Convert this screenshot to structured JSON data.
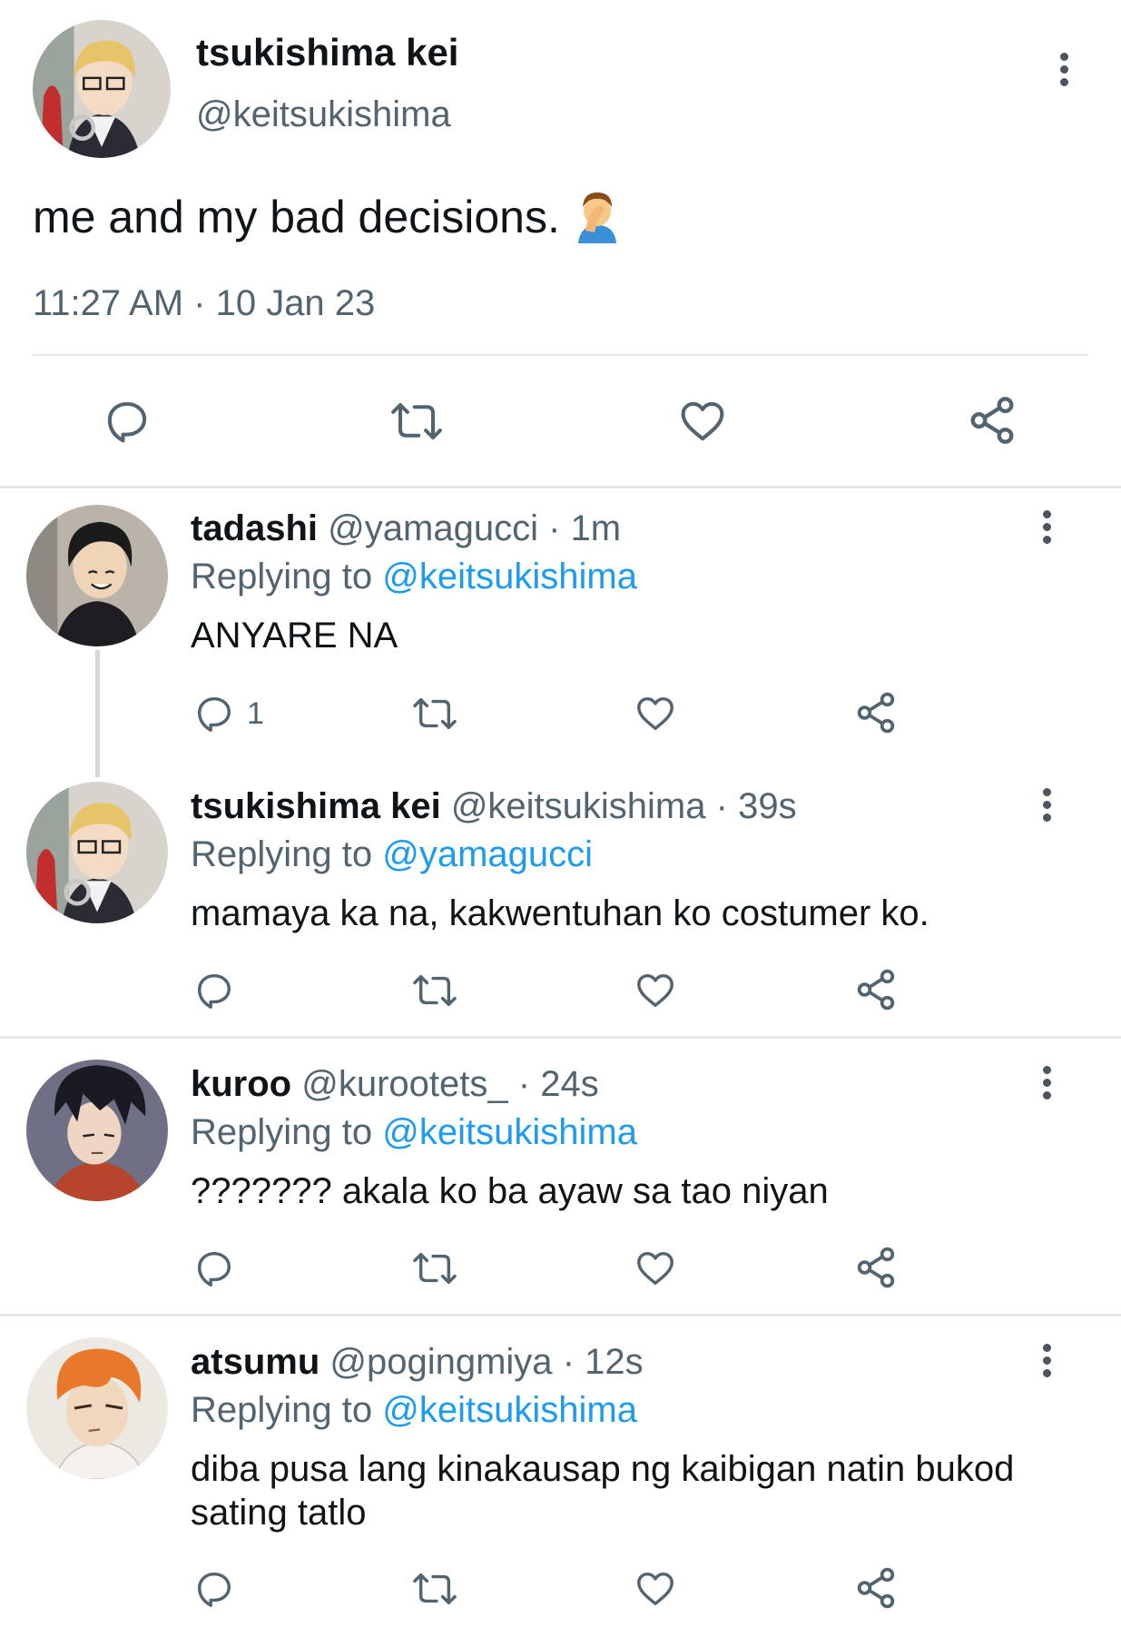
{
  "main_tweet": {
    "name": "tsukishima kei",
    "handle": "@keitsukishima",
    "text": "me and my bad decisions.",
    "emoji": "facepalm-emoji",
    "timestamp": "11:27 AM · 10 Jan 23"
  },
  "replies": [
    {
      "name": "tadashi",
      "handle": "@yamagucci",
      "sep": "·",
      "time": "1m",
      "replying_label": "Replying to",
      "replying_to": "@keitsukishima",
      "text": "ANYARE NA",
      "reply_count": "1"
    },
    {
      "name": "tsukishima kei",
      "handle": "@keitsukishima",
      "sep": "·",
      "time": "39s",
      "replying_label": "Replying to",
      "replying_to": "@yamagucci",
      "text": "mamaya ka na, kakwentuhan ko costumer ko."
    },
    {
      "name": "kuroo",
      "handle": "@kurootets_",
      "sep": "·",
      "time": "24s",
      "replying_label": "Replying to",
      "replying_to": "@keitsukishima",
      "text": "??????? akala ko ba ayaw sa tao niyan"
    },
    {
      "name": "atsumu",
      "handle": "@pogingmiya",
      "sep": "·",
      "time": "12s",
      "replying_label": "Replying to",
      "replying_to": "@keitsukishima",
      "text": "diba pusa lang kinakausap ng kaibigan natin bukod sating tatlo"
    }
  ],
  "icons": [
    "reply-icon",
    "retweet-icon",
    "like-icon",
    "share-icon",
    "more-options-icon"
  ],
  "colors": {
    "link": "#1d9bf0",
    "secondary_text": "#536471",
    "divider": "#e6e9eb"
  }
}
